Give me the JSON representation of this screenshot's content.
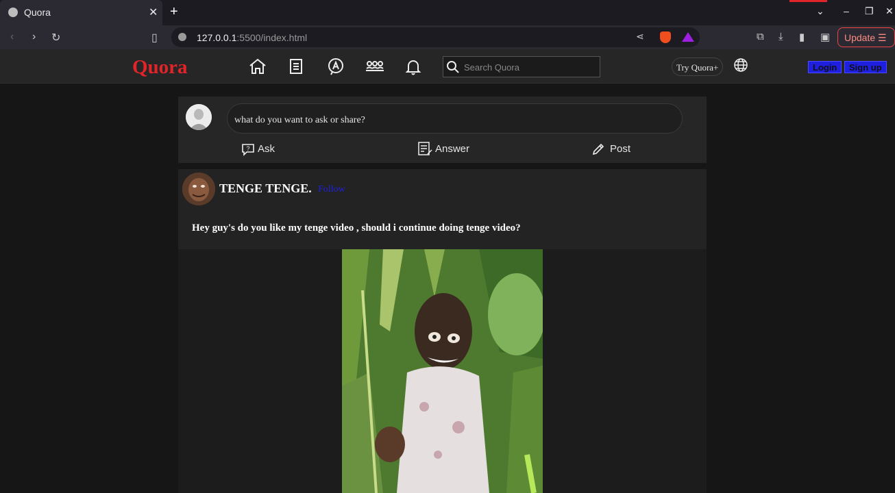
{
  "browser": {
    "tab_title": "Quora",
    "url_host": "127.0.0.1",
    "url_path": ":5500/index.html",
    "update_label": "Update"
  },
  "header": {
    "logo": "Quora",
    "search_placeholder": "Search Quora",
    "try_label": "Try Quora+",
    "login_label": "Login",
    "signup_label": "Sign up"
  },
  "compose": {
    "placeholder": "what do you want to ask or share?",
    "ask_label": "Ask",
    "answer_label": "Answer",
    "post_label": "Post"
  },
  "post": {
    "author": "TENGE TENGE.",
    "follow_label": "Follow",
    "question": "Hey guy's do you like my tenge video , should i continue doing tenge video?"
  },
  "colors": {
    "brand_red": "#e0242a",
    "auth_blue": "#1f1fe0",
    "bg": "#161616",
    "card": "#262626"
  }
}
